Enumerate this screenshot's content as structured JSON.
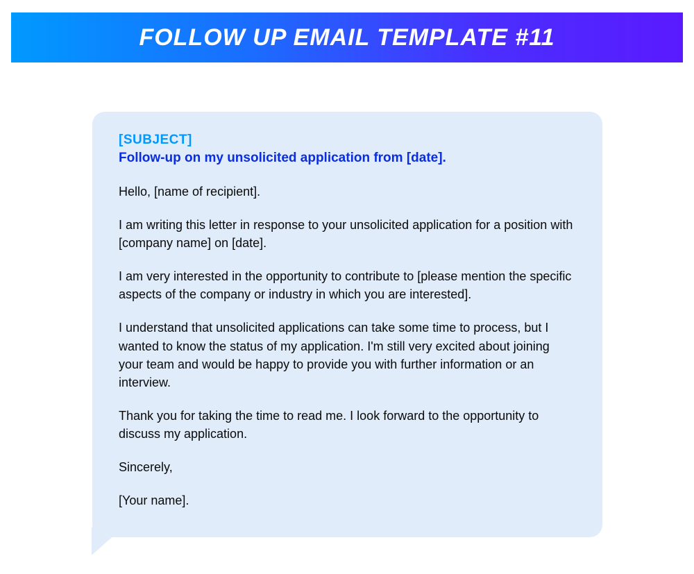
{
  "header": {
    "title": "FOLLOW UP EMAIL TEMPLATE #11"
  },
  "card": {
    "subject_label": "[SUBJECT]",
    "subject_line": "Follow-up on my unsolicited application from [date].",
    "greeting": "Hello, [name of recipient].",
    "para1": "I am writing this letter in response to your unsolicited application for a position with [company name] on [date].",
    "para2": "I am very interested in the opportunity to contribute to [please mention the specific aspects of the company or industry in which you are interested].",
    "para3": "I understand that unsolicited applications can take some time to process, but I wanted to know the status of my application. I'm still very excited about joining your team and would be happy to provide you with further information or an interview.",
    "para4": "Thank you for taking the time to read me. I look forward to the opportunity to discuss my application.",
    "signoff": "Sincerely,",
    "signature": "[Your name]."
  }
}
